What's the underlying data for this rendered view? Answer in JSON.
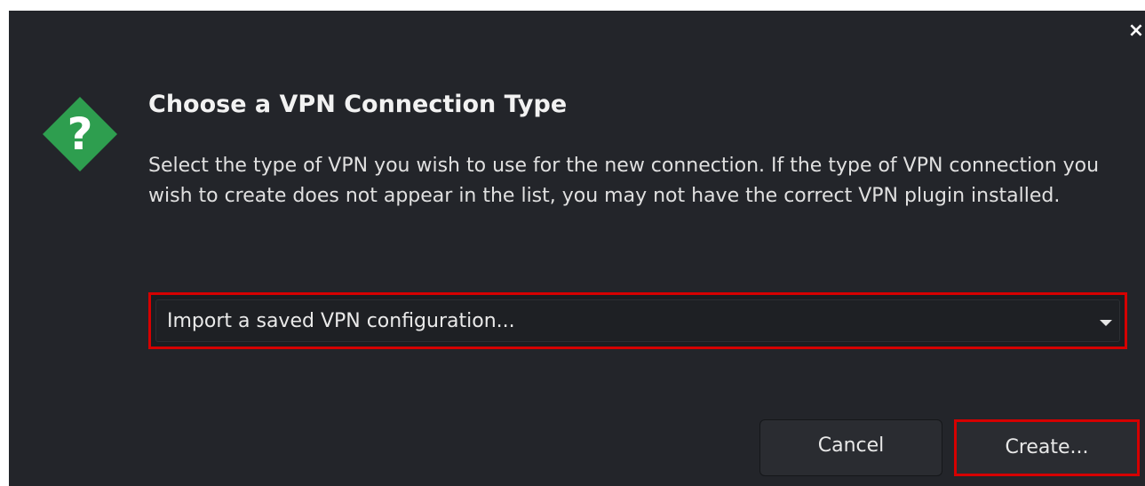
{
  "dialog": {
    "close_glyph": "×",
    "icon": "question-diamond-icon",
    "title": "Choose a VPN Connection Type",
    "message": "Select the type of VPN you wish to use for the new connection. If the type of VPN connection you wish to create does not appear in the list, you may not have the correct VPN plugin installed.",
    "vpn_type_select": {
      "selected": "Import a saved VPN configuration..."
    },
    "buttons": {
      "cancel": "Cancel",
      "create": "Create..."
    }
  },
  "colors": {
    "background": "#23252a",
    "highlight": "#d50000",
    "icon_green": "#2e9e4f"
  }
}
